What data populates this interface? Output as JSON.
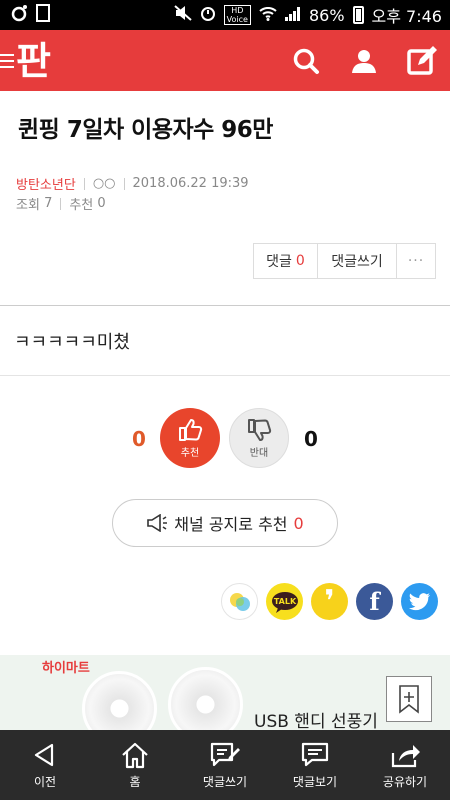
{
  "status_bar": {
    "battery": "86%",
    "time": "오후 7:46",
    "hd_label": "HD",
    "voice_label": "Voice"
  },
  "header": {
    "logo": "판",
    "brand_color": "#e63c3c",
    "icons": [
      "menu-icon",
      "search-icon",
      "user-icon",
      "write-icon"
    ]
  },
  "post": {
    "title": "퀸핑 7일차 이용자수 96만",
    "author": "방탄소년단",
    "author_badge": "○○",
    "date": "2018.06.22 19:39",
    "views_label": "조회",
    "views": "7",
    "recommend_label": "추천",
    "recommend": "0",
    "body": "ㅋㅋㅋㅋㅋ미쳤"
  },
  "comment_bar": {
    "comments_label": "댓글",
    "comments_count": "0",
    "write_label": "댓글쓰기",
    "more_label": "···"
  },
  "vote": {
    "up_count": "0",
    "up_label": "추천",
    "down_count": "0",
    "down_label": "반대"
  },
  "channel": {
    "label": "채널 공지로 추천",
    "count": "0"
  },
  "share": {
    "kakaotalk_label": "TALK",
    "kakaostory_label": "❜",
    "facebook_label": "f"
  },
  "ad": {
    "brand": "하이마트",
    "text": "USB 핸디 선풍기"
  },
  "bottom_nav": [
    {
      "label": "이전",
      "icon": "back-icon"
    },
    {
      "label": "홈",
      "icon": "home-icon"
    },
    {
      "label": "댓글쓰기",
      "icon": "comment-write-icon"
    },
    {
      "label": "댓글보기",
      "icon": "comment-view-icon"
    },
    {
      "label": "공유하기",
      "icon": "share-icon"
    }
  ]
}
